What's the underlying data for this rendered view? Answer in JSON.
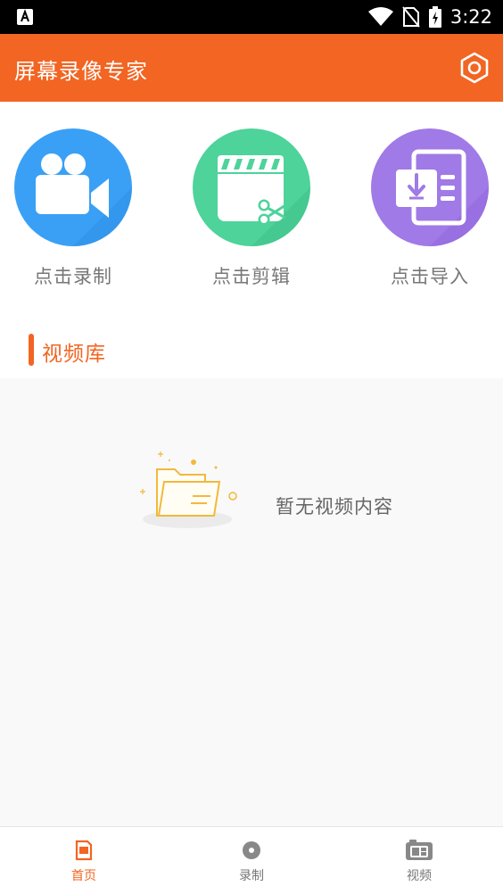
{
  "status_bar": {
    "time": "3:22",
    "icons": [
      "notification-a-icon",
      "wifi-icon",
      "no-sim-icon",
      "battery-charging-icon"
    ]
  },
  "app_bar": {
    "title": "屏幕录像专家",
    "settings_icon": "settings-hexagon-icon"
  },
  "actions": [
    {
      "label": "点击录制",
      "icon": "video-camera-icon",
      "color": "#3aa0f5"
    },
    {
      "label": "点击剪辑",
      "icon": "clapperboard-scissors-icon",
      "color": "#4ed39a"
    },
    {
      "label": "点击导入",
      "icon": "import-document-icon",
      "color": "#a07ae6"
    }
  ],
  "library": {
    "title": "视频库",
    "empty_text": "暂无视频内容",
    "empty_icon": "empty-folder-icon"
  },
  "bottom_nav": {
    "items": [
      {
        "label": "首页",
        "icon": "home-doc-icon",
        "active": true
      },
      {
        "label": "录制",
        "icon": "record-dot-icon",
        "active": false
      },
      {
        "label": "视频",
        "icon": "video-gallery-icon",
        "active": false
      }
    ]
  },
  "colors": {
    "accent": "#f26522",
    "muted_text": "#777777"
  }
}
